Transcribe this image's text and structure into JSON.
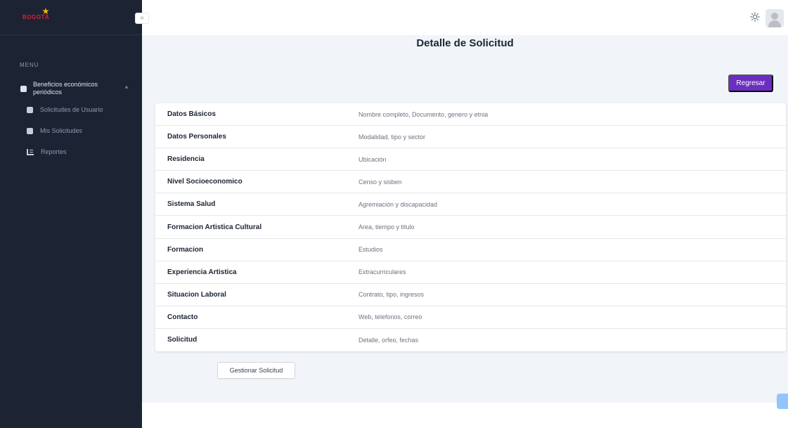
{
  "brand": {
    "logo_text": "BOGOTÁ"
  },
  "header": {
    "collapse_icon": "«",
    "theme_icon": "sun-icon",
    "avatar_icon": "user-avatar-icon"
  },
  "sidebar": {
    "menu_title": "MENU",
    "group": {
      "label": "Beneficios económicos periódicos",
      "expanded": true
    },
    "items": [
      {
        "label": "Solicitudes de Usuario",
        "icon": "database-icon"
      },
      {
        "label": "Mis Solicitudes",
        "icon": "database-icon"
      },
      {
        "label": "Reportes",
        "icon": "chart-icon"
      }
    ]
  },
  "main": {
    "title": "Detalle de Solicitud",
    "back_button": "Regresar",
    "manage_button": "Gestionar Solicitud",
    "sections": [
      {
        "title": "Datos Básicos",
        "description": "Nombre completo, Documento, genero y etnia"
      },
      {
        "title": "Datos Personales",
        "description": "Modalidad, tipo y sector"
      },
      {
        "title": "Residencia",
        "description": "Ubicación"
      },
      {
        "title": "Nivel Socioeconomico",
        "description": "Censo y sisben"
      },
      {
        "title": "Sistema Salud",
        "description": "Agremiación y discapacidad"
      },
      {
        "title": "Formacion Artistica Cultural",
        "description": "Area, tiempo y titulo"
      },
      {
        "title": "Formacion",
        "description": "Estudios"
      },
      {
        "title": "Experiencia Artistica",
        "description": "Extracurriculares"
      },
      {
        "title": "Situacion Laboral",
        "description": "Contrato, tipo, ingresos"
      },
      {
        "title": "Contacto",
        "description": "Web, telefonos, correo"
      },
      {
        "title": "Solicitud",
        "description": "Detalle, orfeo, fechas"
      }
    ]
  },
  "colors": {
    "sidebar_bg": "#1c2434",
    "primary": "#6b2fbf",
    "page_bg": "#f1f5f9"
  }
}
